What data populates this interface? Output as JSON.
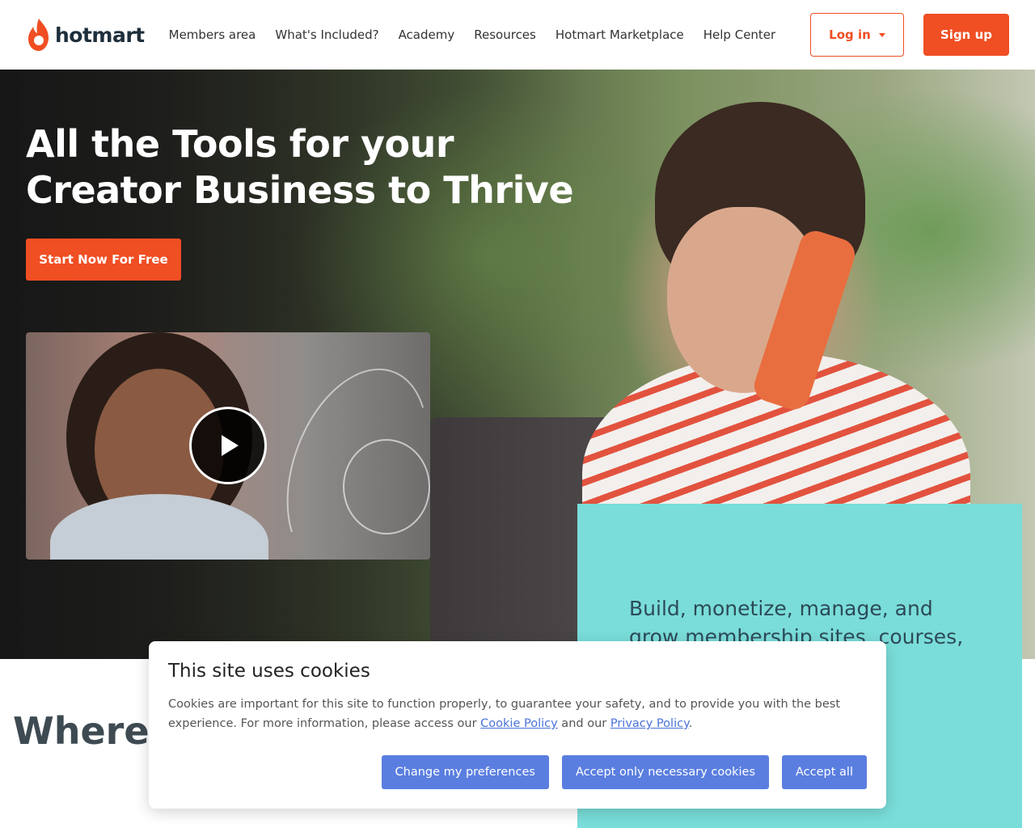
{
  "brand": {
    "name": "hotmart",
    "accent": "#f04e23"
  },
  "nav": {
    "items": [
      {
        "label": "Members area"
      },
      {
        "label": "What's Included?"
      },
      {
        "label": "Academy"
      },
      {
        "label": "Resources"
      },
      {
        "label": "Hotmart Marketplace"
      },
      {
        "label": "Help Center"
      }
    ],
    "login_label": "Log in",
    "signup_label": "Sign up"
  },
  "hero": {
    "title": "All the Tools for your Creator Business to Thrive",
    "cta_label": "Start Now For Free"
  },
  "teal_panel": {
    "text": "Build, monetize, manage, and grow membership sites, courses, events, ur"
  },
  "section": {
    "heading": "Where create"
  },
  "cookie": {
    "title": "This site uses cookies",
    "body_prefix": "Cookies are important for this site to function properly, to guarantee your safety, and to provide you with the best experience. For more information, please access our ",
    "cookie_policy_link": "Cookie Policy",
    "body_middle": " and our ",
    "privacy_policy_link": "Privacy Policy",
    "body_suffix": ".",
    "buttons": {
      "preferences": "Change my preferences",
      "necessary": "Accept only necessary cookies",
      "accept_all": "Accept all"
    }
  }
}
